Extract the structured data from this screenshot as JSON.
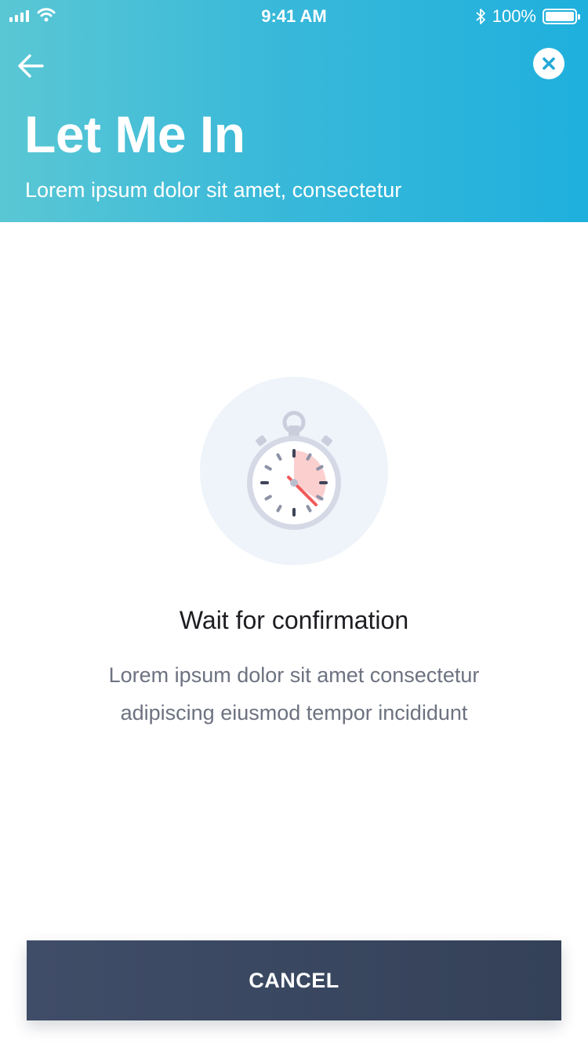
{
  "status_bar": {
    "time": "9:41 AM",
    "battery": "100%"
  },
  "header": {
    "title": "Let Me In",
    "subtitle": "Lorem ipsum dolor sit amet, consectetur",
    "back_icon": "arrow-left-icon",
    "close_icon": "close-circle-icon"
  },
  "content": {
    "illustration_icon": "stopwatch-icon",
    "heading": "Wait for confirmation",
    "description": "Lorem ipsum dolor sit amet consectetur adipiscing eiusmod tempor incididunt"
  },
  "footer": {
    "cancel_label": "CANCEL"
  },
  "colors": {
    "header_start": "#5ac7d4",
    "header_end": "#1fb0dd",
    "button_bg": "#3b4862",
    "accent_red": "#f25a5a"
  }
}
